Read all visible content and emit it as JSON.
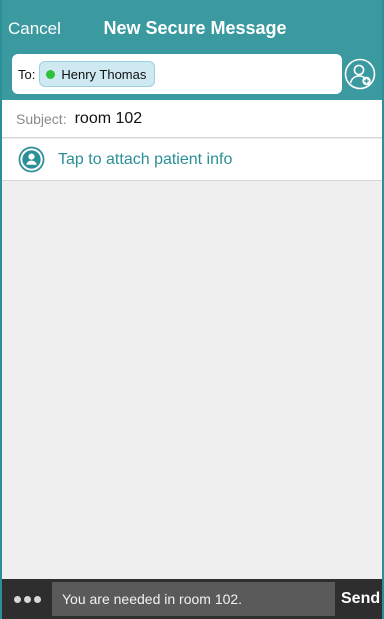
{
  "header": {
    "cancel_label": "Cancel",
    "title": "New Secure Message",
    "background_color": "#3a9aa0",
    "add_contact_icon": "add-contact-icon"
  },
  "recipients": {
    "to_label": "To:",
    "items": [
      {
        "name": "Henry Thomas",
        "status_color": "#2ec23a"
      }
    ]
  },
  "subject": {
    "label": "Subject:",
    "value": "room 102"
  },
  "attach": {
    "label": "Tap to attach patient info",
    "icon": "patient-icon",
    "accent_color": "#2b8f97"
  },
  "composer": {
    "more_icon": "more-dots-icon",
    "message_text": "You are needed in room 102.",
    "send_label": "Send"
  }
}
